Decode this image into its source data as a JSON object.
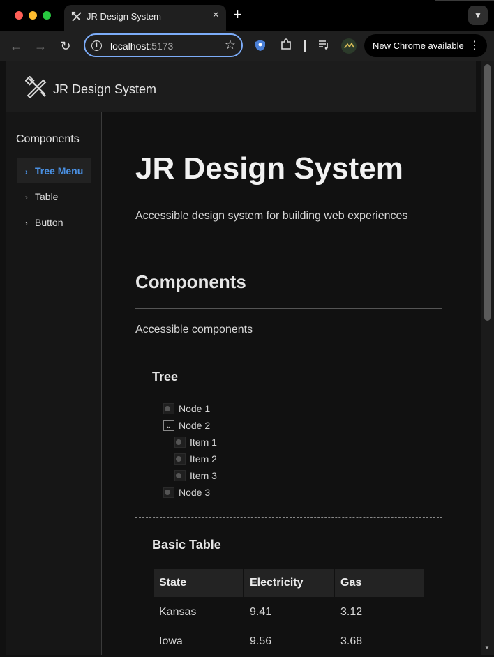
{
  "browser": {
    "tab_title": "JR Design System",
    "tab_close": "×",
    "new_tab": "+",
    "url_host": "localhost",
    "url_port": ":5173",
    "update_button": "New Chrome available",
    "menu_glyph": "⋮"
  },
  "header": {
    "title": "JR Design System",
    "logo_icon": "design-tools-icon"
  },
  "sidebar": {
    "heading": "Components",
    "items": [
      {
        "label": "Tree Menu",
        "active": true
      },
      {
        "label": "Table",
        "active": false
      },
      {
        "label": "Button",
        "active": false
      }
    ]
  },
  "main": {
    "title": "JR Design System",
    "subtitle": "Accessible design system for building web experiences",
    "section_title": "Components",
    "section_desc": "Accessible components",
    "tree": {
      "title": "Tree",
      "nodes": [
        {
          "label": "Node 1",
          "expanded": false
        },
        {
          "label": "Node 2",
          "expanded": true,
          "children": [
            "Item 1",
            "Item 2",
            "Item 3"
          ]
        },
        {
          "label": "Node 3",
          "expanded": false
        }
      ]
    },
    "table": {
      "title": "Basic Table",
      "columns": [
        "State",
        "Electricity",
        "Gas"
      ],
      "rows": [
        [
          "Kansas",
          "9.41",
          "3.12"
        ],
        [
          "Iowa",
          "9.56",
          "3.68"
        ]
      ]
    }
  },
  "colors": {
    "accent": "#4a90e2",
    "background": "#111111",
    "surface": "#1c1c1c"
  }
}
